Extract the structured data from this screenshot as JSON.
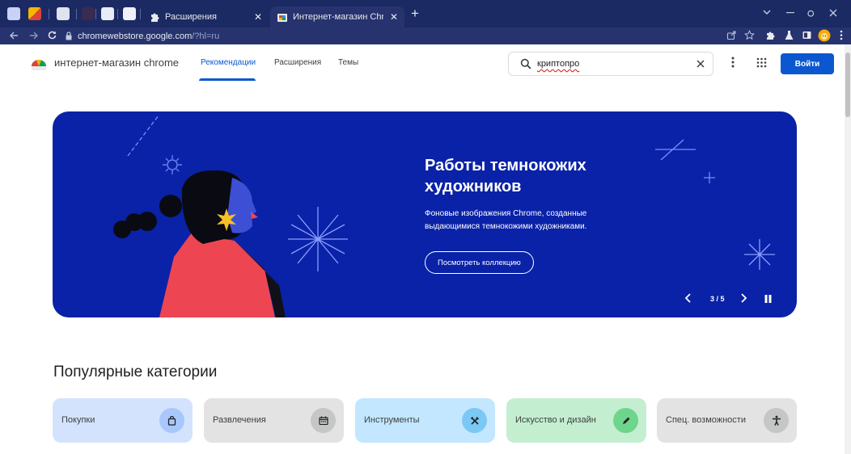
{
  "browser": {
    "tabs": [
      {
        "title": "Расширения",
        "active": false,
        "favicon": "puzzle-icon"
      },
      {
        "title": "Интернет-магазин Chrome",
        "active": true,
        "favicon": "webstore-icon"
      }
    ],
    "new_tab_glyph": "+",
    "close_glyph": "✕",
    "url_host": "chromewebstore.google.com",
    "url_path": "/?hl=ru"
  },
  "store": {
    "name": "интернет-магазин chrome",
    "nav": [
      {
        "label": "Рекомендации",
        "active": true
      },
      {
        "label": "Расширения",
        "active": false
      },
      {
        "label": "Темы",
        "active": false
      }
    ],
    "search_value": "криптопро",
    "sign_in": "Войти"
  },
  "banner": {
    "title": "Работы темнокожих художников",
    "subtitle": "Фоновые изображения Chrome, созданные выдающимися темнокожими художниками.",
    "button": "Посмотреть коллекцию",
    "counter": "3 / 5",
    "background": "#0a22a7"
  },
  "categories": {
    "title": "Популярные категории",
    "items": [
      {
        "label": "Покупки",
        "icon": "shopping-bag-icon",
        "bg": "#d3e3fd",
        "circle": "#a8c7fa"
      },
      {
        "label": "Развлечения",
        "icon": "calendar-icon",
        "bg": "#e3e3e3",
        "circle": "#c4c7c5"
      },
      {
        "label": "Инструменты",
        "icon": "tools-icon",
        "bg": "#c2e7ff",
        "circle": "#7cc8f5"
      },
      {
        "label": "Искусство и дизайн",
        "icon": "pencil-icon",
        "bg": "#c4eed0",
        "circle": "#6dd58c"
      },
      {
        "label": "Спец. возможности",
        "icon": "accessibility-icon",
        "bg": "#e3e3e3",
        "circle": "#c4c7c5"
      }
    ]
  },
  "colors": {
    "accent": "#0b57d0",
    "browser_frame": "#1c2a63",
    "toolbar": "#26336f"
  }
}
